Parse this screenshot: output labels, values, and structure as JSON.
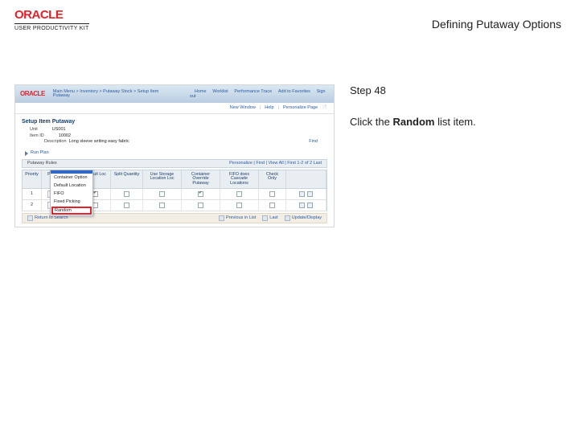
{
  "header": {
    "brand": "ORACLE",
    "subbrand": "USER PRODUCTIVITY KIT",
    "lesson_title": "Defining Putaway Options"
  },
  "right": {
    "step_label": "Step 48",
    "text_prefix": "Click the ",
    "text_bold": "Random",
    "text_suffix": " list item."
  },
  "app": {
    "brand": "ORACLE",
    "breadcrumb": "Main Menu > Inventory > Putaway Stock > Setup Item Putaway",
    "nav": [
      "Home",
      "Worklist",
      "Performance Trace",
      "Add to Favorites",
      "Sign out"
    ],
    "subnav": [
      "New Window",
      "Help",
      "Personalize Page"
    ],
    "page_title": "Setup Item Putaway",
    "unit_k": "Unit",
    "unit_v": "US001",
    "item_k": "Item ID",
    "item_v": "10002",
    "desc_k": "Description",
    "desc_v": "Long sleeve writing easy fabric",
    "find_link": "Find",
    "run_plan": "Run Plan",
    "rulebar_left": "Putaway Rules",
    "rulebar_right": "Personalize | Find | View All |  First  1-2 of 2  Last",
    "cols": [
      "Priority",
      "Putaway Rule",
      "Default Loc",
      "Split Quantity",
      "Use Storage Location Loc",
      "Container Override Putaway",
      "FIFO does Cascade Locations",
      "Check Only"
    ],
    "rule_value": "FIXED PICKING",
    "drop_options": [
      "",
      "Container Option",
      "Default Location",
      "FIFO",
      "Fixed Picking",
      "Random"
    ],
    "foot_return": "Return to Search",
    "foot_up": "Previous in List",
    "foot_last": "Last",
    "foot_update": "Update/Display"
  }
}
